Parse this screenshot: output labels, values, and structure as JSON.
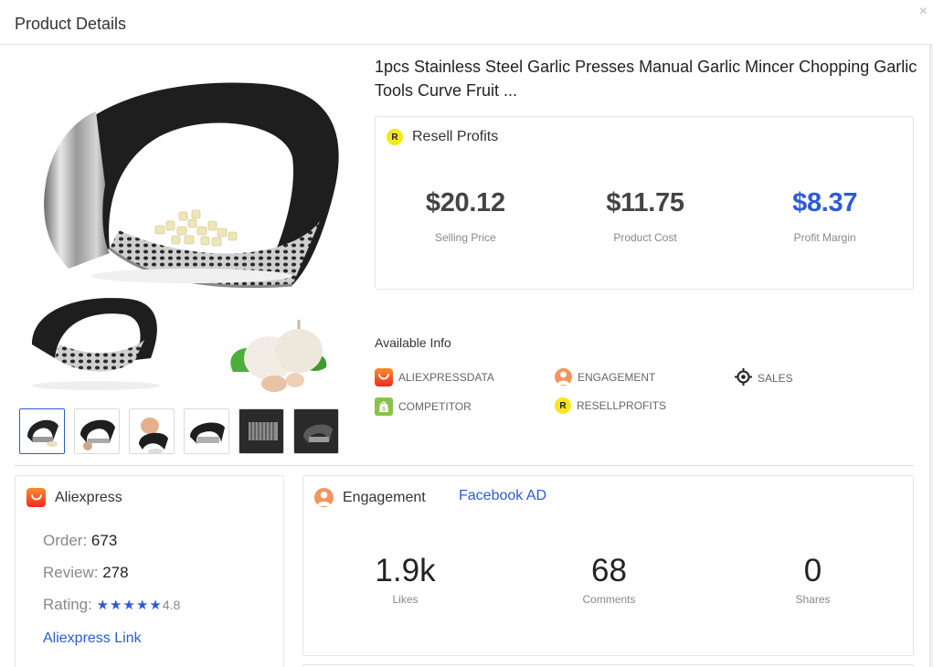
{
  "window": {
    "title": "Product Details",
    "close_glyph": "×"
  },
  "product": {
    "title": "1pcs Stainless Steel Garlic Presses Manual Garlic Mincer Chopping Garlic Tools Curve Fruit ...",
    "thumbnail_count": 6,
    "active_thumbnail": 1
  },
  "resell": {
    "badge": "R",
    "heading": "Resell Profits",
    "metrics": [
      {
        "value": "$20.12",
        "label": "Selling Price"
      },
      {
        "value": "$11.75",
        "label": "Product Cost"
      },
      {
        "value": "$8.37",
        "label": "Profit Margin"
      }
    ]
  },
  "available_info": {
    "label": "Available Info",
    "items": [
      {
        "label": "ALIEXPRESSDATA",
        "icon": "aliexpress-icon"
      },
      {
        "label": "ENGAGEMENT",
        "icon": "engagement-icon"
      },
      {
        "label": "SALES",
        "icon": "crosshair-icon"
      },
      {
        "label": "COMPETITOR",
        "icon": "shopify-bag-icon"
      },
      {
        "label": "RESELLPROFITS",
        "icon": "resellprofits-icon"
      }
    ]
  },
  "aliexpress": {
    "heading": "Aliexpress",
    "order_label": "Order:",
    "order_value": "673",
    "review_label": "Review:",
    "review_value": "278",
    "rating_label": "Rating:",
    "stars": "★★★★★",
    "rating_value": "4.8",
    "link": "Aliexpress Link"
  },
  "engagement": {
    "heading": "Engagement",
    "facebook_link": "Facebook AD",
    "metrics": [
      {
        "value": "1.9k",
        "label": "Likes"
      },
      {
        "value": "68",
        "label": "Comments"
      },
      {
        "value": "0",
        "label": "Shares"
      }
    ]
  },
  "colors": {
    "accent_blue": "#2d5bd7",
    "resell_badge_yellow": "#f7e71a",
    "aliexpress_red": "#ee2a22",
    "engagement_orange": "#f3955f",
    "competitor_green": "#8ac24a"
  }
}
